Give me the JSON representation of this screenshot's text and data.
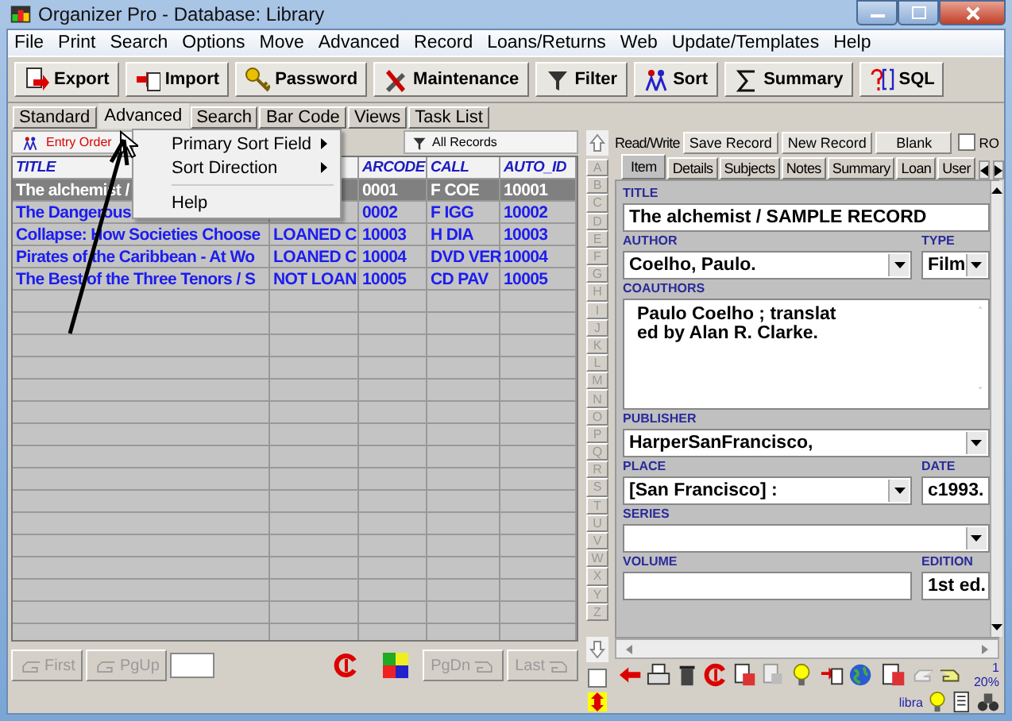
{
  "window": {
    "title": "Organizer Pro - Database: Library"
  },
  "menu": [
    "File",
    "Print",
    "Search",
    "Options",
    "Move",
    "Advanced",
    "Record",
    "Loans/Returns",
    "Web",
    "Update/Templates",
    "Help"
  ],
  "toolbar": [
    "Export",
    "Import",
    "Password",
    "Maintenance",
    "Filter",
    "Sort",
    "Summary",
    "SQL"
  ],
  "view_tabs": [
    {
      "label": "Standard",
      "selected": false
    },
    {
      "label": "Advanced",
      "selected": true
    },
    {
      "label": "Search",
      "selected": false
    },
    {
      "label": "Bar Code",
      "selected": false
    },
    {
      "label": "Views",
      "selected": false
    },
    {
      "label": "Task List",
      "selected": false
    }
  ],
  "grid": {
    "sort_button": "Entry Order",
    "filter_button": "All Records",
    "columns": [
      "TITLE",
      null,
      "ARCODE",
      "CALL",
      "AUTO_ID"
    ],
    "rows": [
      {
        "cells": [
          "The alchemist /",
          null,
          "0001",
          "F COE",
          "10001"
        ],
        "selected": true
      },
      {
        "cells": [
          "The Dangerous",
          null,
          "0002",
          "F IGG",
          "10002"
        ],
        "selected": false
      },
      {
        "cells": [
          "Collapse: How Societies Choose",
          "LOANED C",
          "10003",
          "H DIA",
          "10003"
        ],
        "selected": false
      },
      {
        "cells": [
          "Pirates of the Caribbean - At Wo",
          "LOANED C",
          "10004",
          "DVD VER",
          "10004"
        ],
        "selected": false
      },
      {
        "cells": [
          "The Best of the Three Tenors / S",
          "NOT LOAN",
          "10005",
          "CD PAV",
          "10005"
        ],
        "selected": false
      }
    ]
  },
  "context_menu": [
    {
      "kind": "item",
      "label": "Primary Sort Field",
      "submenu": true
    },
    {
      "kind": "item",
      "label": "Sort Direction",
      "submenu": true
    },
    {
      "kind": "separator"
    },
    {
      "kind": "item",
      "label": "Help",
      "submenu": false
    }
  ],
  "nav": [
    {
      "label": "First",
      "disabled": true
    },
    {
      "label": "PgUp",
      "disabled": true
    },
    {
      "label": "PgDn",
      "disabled": true
    },
    {
      "label": "Last",
      "disabled": true
    }
  ],
  "alpha_checkbox": {
    "checked": false
  },
  "letters": [
    "A",
    "B",
    "C",
    "D",
    "E",
    "F",
    "G",
    "H",
    "I",
    "J",
    "K",
    "L",
    "M",
    "N",
    "O",
    "P",
    "Q",
    "R",
    "S",
    "T",
    "U",
    "V",
    "W",
    "X",
    "Y",
    "Z"
  ],
  "record_bar": {
    "mode": "Read/Write",
    "buttons": [
      "Save Record",
      "New Record",
      "Blank"
    ],
    "ro": {
      "label": "RO",
      "checked": false
    }
  },
  "record_tabs": [
    {
      "label": "Item",
      "selected": true
    },
    {
      "label": "Details",
      "selected": false
    },
    {
      "label": "Subjects",
      "selected": false
    },
    {
      "label": "Notes",
      "selected": false
    },
    {
      "label": "Summary",
      "selected": false
    },
    {
      "label": "Loan",
      "selected": false
    },
    {
      "label": "User",
      "selected": false
    }
  ],
  "form": [
    [
      {
        "kind": "text",
        "label": "TITLE",
        "value": "The alchemist / SAMPLE RECORD"
      }
    ],
    [
      {
        "kind": "combo",
        "label": "AUTHOR",
        "value": "Coelho, Paulo."
      },
      {
        "kind": "combo",
        "label": "TYPE",
        "value": "Film"
      }
    ],
    [
      {
        "kind": "memo",
        "label": "COAUTHORS",
        "lines": [
          "Paulo Coelho ; translat",
          "ed by Alan R. Clarke."
        ]
      }
    ],
    [
      {
        "kind": "combo",
        "label": "PUBLISHER",
        "value": "HarperSanFrancisco,"
      }
    ],
    [
      {
        "kind": "combo",
        "label": "PLACE",
        "value": "[San Francisco] :"
      },
      {
        "kind": "text",
        "label": "DATE",
        "value": "c1993."
      }
    ],
    [
      {
        "kind": "combo",
        "label": "SERIES"
      }
    ],
    [
      {
        "kind": "text",
        "label": "VOLUME"
      },
      {
        "kind": "text",
        "label": "EDITION",
        "value": "1st ed."
      }
    ]
  ],
  "status": {
    "record_number": "1",
    "percent": "20%",
    "database": "libra"
  }
}
